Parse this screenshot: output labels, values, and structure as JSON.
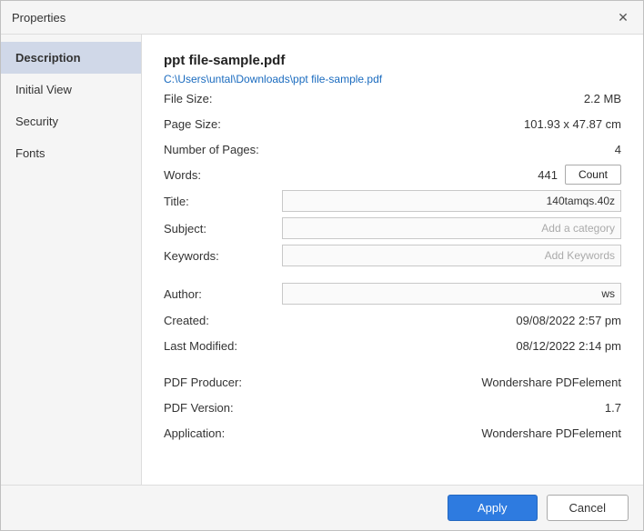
{
  "dialog": {
    "title": "Properties",
    "close_label": "✕"
  },
  "sidebar": {
    "items": [
      {
        "id": "description",
        "label": "Description",
        "active": true
      },
      {
        "id": "initial-view",
        "label": "Initial View",
        "active": false
      },
      {
        "id": "security",
        "label": "Security",
        "active": false
      },
      {
        "id": "fonts",
        "label": "Fonts",
        "active": false
      }
    ]
  },
  "main": {
    "file_name": "ppt file-sample.pdf",
    "file_path": "C:\\Users\\untal\\Downloads\\ppt file-sample.pdf",
    "properties": [
      {
        "label": "File Size:",
        "value": "2.2 MB",
        "input": false
      },
      {
        "label": "Page Size:",
        "value": "101.93 x 47.87 cm",
        "input": false
      },
      {
        "label": "Number of Pages:",
        "value": "4",
        "input": false
      }
    ],
    "words_label": "Words:",
    "words_count": "441",
    "count_button": "Count",
    "title_label": "Title:",
    "title_value": "140tamqs.40z",
    "subject_label": "Subject:",
    "subject_placeholder": "Add a category",
    "keywords_label": "Keywords:",
    "keywords_placeholder": "Add Keywords",
    "author_label": "Author:",
    "author_value": "ws",
    "created_label": "Created:",
    "created_value": "09/08/2022 2:57 pm",
    "last_modified_label": "Last Modified:",
    "last_modified_value": "08/12/2022 2:14 pm",
    "pdf_producer_label": "PDF Producer:",
    "pdf_producer_value": "Wondershare PDFelement",
    "pdf_version_label": "PDF Version:",
    "pdf_version_value": "1.7",
    "application_label": "Application:",
    "application_value": "Wondershare PDFelement"
  },
  "footer": {
    "apply_label": "Apply",
    "cancel_label": "Cancel"
  }
}
